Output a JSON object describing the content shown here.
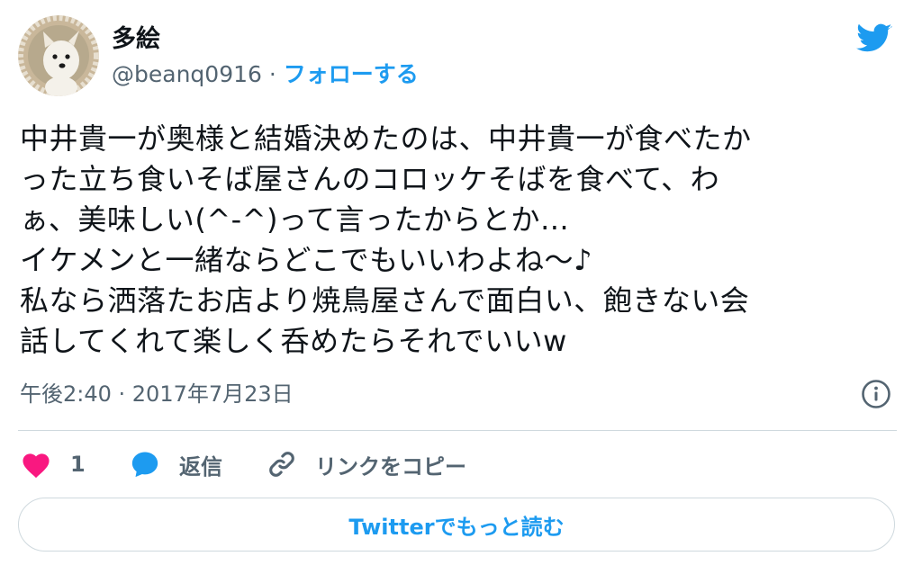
{
  "author": {
    "display_name": "多絵",
    "handle": "@beanq0916",
    "separator": "·",
    "follow_label": "フォローする",
    "avatar_icon": "dog-avatar"
  },
  "brand": {
    "icon": "twitter-bird-icon",
    "color": "#1d9bf0"
  },
  "tweet": {
    "text": "中井貴一が奥様と結婚決めたのは、中井貴一が食べたか\nった立ち食いそば屋さんのコロッケそばを食べて、わ\nぁ、美味しい(^-^)って言ったからとか…\nイケメンと一緒ならどこでもいいわよね〜♪\n私なら洒落たお店より焼鳥屋さんで面白い、飽きない会\n話してくれて楽しく呑めたらそれでいいw",
    "timestamp": "午後2:40 · 2017年7月23日"
  },
  "actions": {
    "like_count": "1",
    "reply_label": "返信",
    "copy_link_label": "リンクをコピー",
    "like_color": "#f91880"
  },
  "read_more_label": "Twitterでもっと読む"
}
